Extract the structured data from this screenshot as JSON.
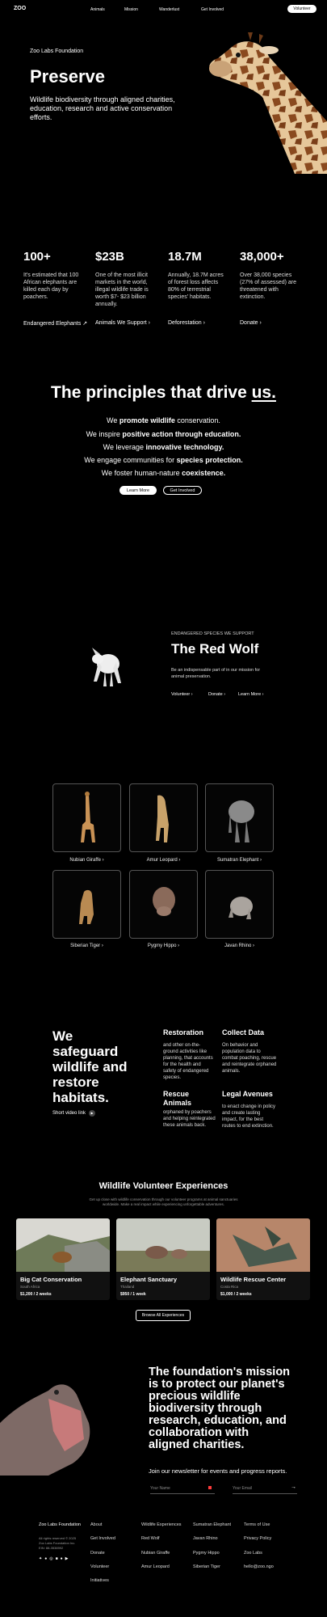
{
  "nav": {
    "logo": "ZOO",
    "items": [
      "Animals",
      "Mission",
      "Wanderlust",
      "Get Involved"
    ],
    "volunteer": "Volunteer"
  },
  "hero": {
    "foundation": "Zoo Labs Foundation",
    "title": "Preserve",
    "text": "Wildlife biodiversity through aligned charities, education, research and active conservation efforts."
  },
  "stats": [
    {
      "number": "100+",
      "text": "It's estimated that 100 African elephants are killed each day by poachers.",
      "link": "Endangered Elephants",
      "arrow": "↗"
    },
    {
      "number": "$23B",
      "text": "One of the most illicit markets in the world, illegal wildlife trade is worth $7- $23 billion annually.",
      "link": "Animals We Support",
      "arrow": "›"
    },
    {
      "number": "18.7M",
      "text": "Annually, 18.7M acres of forest loss affects 80% of terrestrial species' habitats.",
      "link": "Deforestation",
      "arrow": "›"
    },
    {
      "number": "38,000+",
      "text": "Over 38,000 species (27% of assessed) are threatened with extinction.",
      "link": "Donate",
      "arrow": "›"
    }
  ],
  "principles": {
    "title_a": "The principles that drive ",
    "title_b": "us.",
    "lines": [
      {
        "pre": "We ",
        "bold": "promote wildlife",
        "post": " conservation."
      },
      {
        "pre": "We inspire ",
        "bold": "positive action through education.",
        "post": ""
      },
      {
        "pre": "We leverage ",
        "bold": "innovative technology.",
        "post": ""
      },
      {
        "pre": "We engage communities for ",
        "bold": "species protection.",
        "post": ""
      },
      {
        "pre": "We foster human-nature ",
        "bold": "coexistence.",
        "post": ""
      }
    ],
    "learn_more": "Learn More",
    "get_involved": "Get Involved"
  },
  "featured": {
    "eyebrow": "ENDANGERED SPECIES WE SUPPORT",
    "title": "The Red Wolf",
    "text": "Be an indispensable part of in our mission for animal preservation.",
    "links": [
      "Volunteer",
      "Donate",
      "Learn More"
    ],
    "arrow": "›"
  },
  "animals": [
    {
      "name": "Nubian Giraffe",
      "arrow": "›"
    },
    {
      "name": "Amur Leopard",
      "arrow": "›"
    },
    {
      "name": "Sumatran Elephant",
      "arrow": "›"
    },
    {
      "name": "Siberian Tiger",
      "arrow": "›"
    },
    {
      "name": "Pygmy Hippo",
      "arrow": "›"
    },
    {
      "name": "Javan Rhino",
      "arrow": "›"
    }
  ],
  "safeguard": {
    "title": "We safeguard wildlife and restore habitats.",
    "video": "Short video link",
    "items": [
      {
        "title": "Restoration",
        "text": "and other on-the-ground activities like planning, that accounts for the health and safety of endangered species."
      },
      {
        "title": "Collect Data",
        "text": "On behavior and population data to combat poaching, rescue and reintegrate orphaned animals."
      },
      {
        "title": "Rescue Animals",
        "text": "orphaned by poachers and helping reintegrated these animals back."
      },
      {
        "title": "Legal Avenues",
        "text": "to enact change in policy and create lasting impact, for the best routes to end extinction."
      }
    ]
  },
  "volunteer": {
    "title": "Wildlife Volunteer Experiences",
    "text": "Get up close with wildlife conservation through our volunteer programs at animal sanctuaries worldwide. Make a real impact while experiencing unforgettable adventures.",
    "cards": [
      {
        "title": "Big Cat Conservation",
        "location": "South Africa",
        "price": "$1,200 / 2 weeks"
      },
      {
        "title": "Elephant Sanctuary",
        "location": "Thailand",
        "price": "$950 / 1 week"
      },
      {
        "title": "Wildlife Rescue Center",
        "location": "Costa Rica",
        "price": "$1,000 / 2 weeks"
      }
    ],
    "browse": "Browse All Experiences"
  },
  "mission": {
    "text": "The foundation's mission is to protect our planet's precious wildlife biodiversity through research, education, and collaboration with aligned charities.",
    "newsletter": "Join our newsletter for events and progress reports.",
    "name_placeholder": "Your Name",
    "email_placeholder": "Your Email",
    "submit": "→"
  },
  "footer": {
    "name": "Zoo Labs Foundation",
    "legal": [
      "All rights reserved © 2025",
      "Zoo Labs Foundation Inc.",
      "EIN: 88-3538992"
    ],
    "col1": [
      "About",
      "Get Involved",
      "Donate",
      "Volunteer",
      "Initiatives"
    ],
    "col2": [
      "Wildlife Experiences",
      "Red Wolf",
      "Nubian Giraffe",
      "Amur Leopard"
    ],
    "col3": [
      "Sumatran Elephant",
      "Javan Rhino",
      "Pygmy Hippo",
      "Siberian Tiger"
    ],
    "col4": [
      "Terms of Use",
      "Privacy Policy",
      "Zoo Labs",
      "hello@zoo.ngo"
    ]
  },
  "colors": {
    "accent": "#ff3b3b",
    "background": "#000000",
    "text": "#ffffff"
  }
}
